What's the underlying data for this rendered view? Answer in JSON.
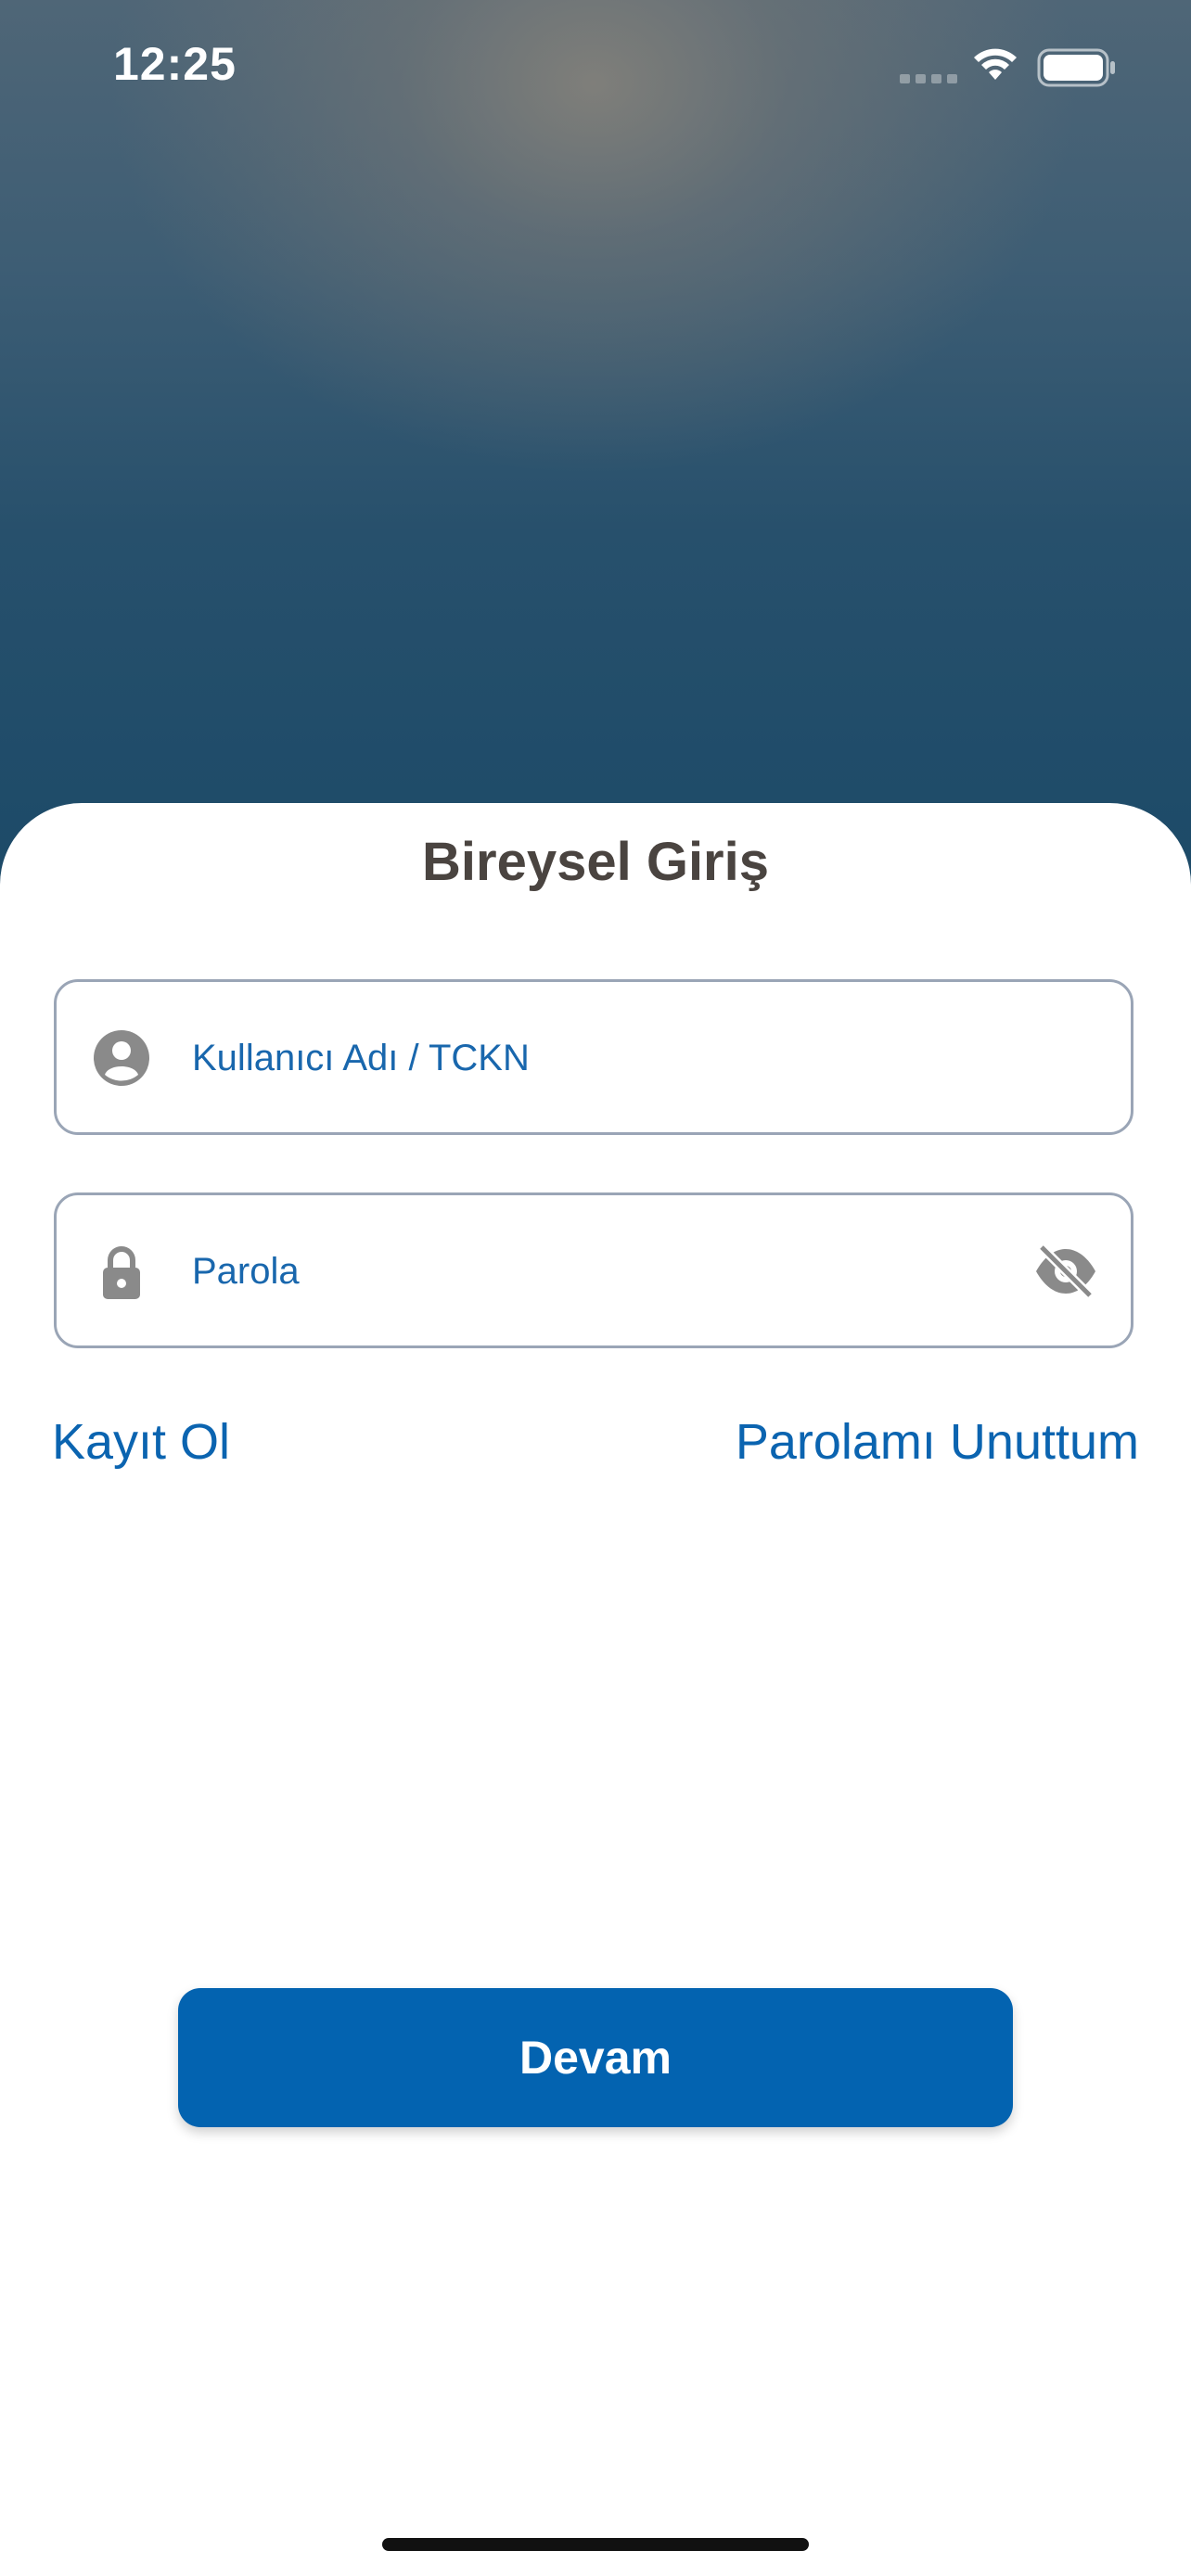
{
  "status_bar": {
    "time": "12:25",
    "icons": [
      "cellular-signal-icon",
      "wifi-icon",
      "battery-icon"
    ]
  },
  "login": {
    "title": "Bireysel Giriş",
    "username": {
      "placeholder": "Kullanıcı Adı / TCKN",
      "value": "",
      "icon": "user-circle-icon"
    },
    "password": {
      "placeholder": "Parola",
      "value": "",
      "icon": "lock-icon",
      "toggle_icon": "eye-slash-icon"
    },
    "register_link": "Kayıt Ol",
    "forgot_link": "Parolamı Unuttum",
    "continue_button": "Devam"
  },
  "colors": {
    "accent": "#0363b0",
    "link": "#0b64b0",
    "title": "#4a4440",
    "field_border": "#9aa5b6",
    "icon_gray": "#8a8a8a"
  }
}
